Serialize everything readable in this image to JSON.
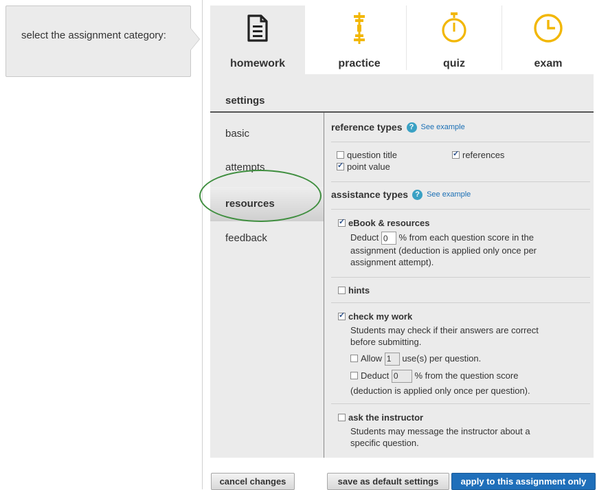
{
  "prompt": {
    "text": "select the assignment category:"
  },
  "categories": [
    {
      "label": "homework",
      "icon": "document-icon",
      "selected": true
    },
    {
      "label": "practice",
      "icon": "barbell-icon"
    },
    {
      "label": "quiz",
      "icon": "stopwatch-icon"
    },
    {
      "label": "exam",
      "icon": "clock-icon"
    }
  ],
  "settings": {
    "title": "settings",
    "nav": [
      {
        "label": "basic"
      },
      {
        "label": "attempts"
      },
      {
        "label": "resources",
        "selected": true
      },
      {
        "label": "feedback"
      }
    ]
  },
  "reference_types": {
    "heading": "reference types",
    "help_glyph": "?",
    "see_example": "See example",
    "options": [
      {
        "label": "question title",
        "checked": false
      },
      {
        "label": "references",
        "checked": true
      },
      {
        "label": "point value",
        "checked": true
      }
    ]
  },
  "assistance_types": {
    "heading": "assistance types",
    "help_glyph": "?",
    "see_example": "See example",
    "ebook": {
      "label": "eBook & resources",
      "checked": true,
      "deduct_prefix": "Deduct",
      "deduct_value": "0",
      "deduct_suffix": "% from each question score in the assignment (deduction is applied only once per assignment attempt)."
    },
    "hints": {
      "label": "hints",
      "checked": false
    },
    "check_my_work": {
      "label": "check my work",
      "checked": true,
      "description": "Students may check if their answers are correct before submitting.",
      "allow_prefix": "Allow",
      "allow_value": "1",
      "allow_suffix": "use(s) per question.",
      "allow_checked": false,
      "deduct_prefix": "Deduct",
      "deduct_value": "0",
      "deduct_suffix": "% from the question score",
      "deduct_note": "(deduction is applied only once per question).",
      "deduct_checked": false
    },
    "ask_instructor": {
      "label": "ask the instructor",
      "checked": false,
      "description": "Students may message the instructor about a specific question."
    }
  },
  "footer": {
    "cancel": "cancel changes",
    "save_default": "save as default settings",
    "apply": "apply to this assignment only"
  },
  "colors": {
    "accent": "#1f6fba",
    "help": "#3aa1c4",
    "highlight_ring": "#3f8e3f",
    "icon_gold": "#f2b705"
  }
}
